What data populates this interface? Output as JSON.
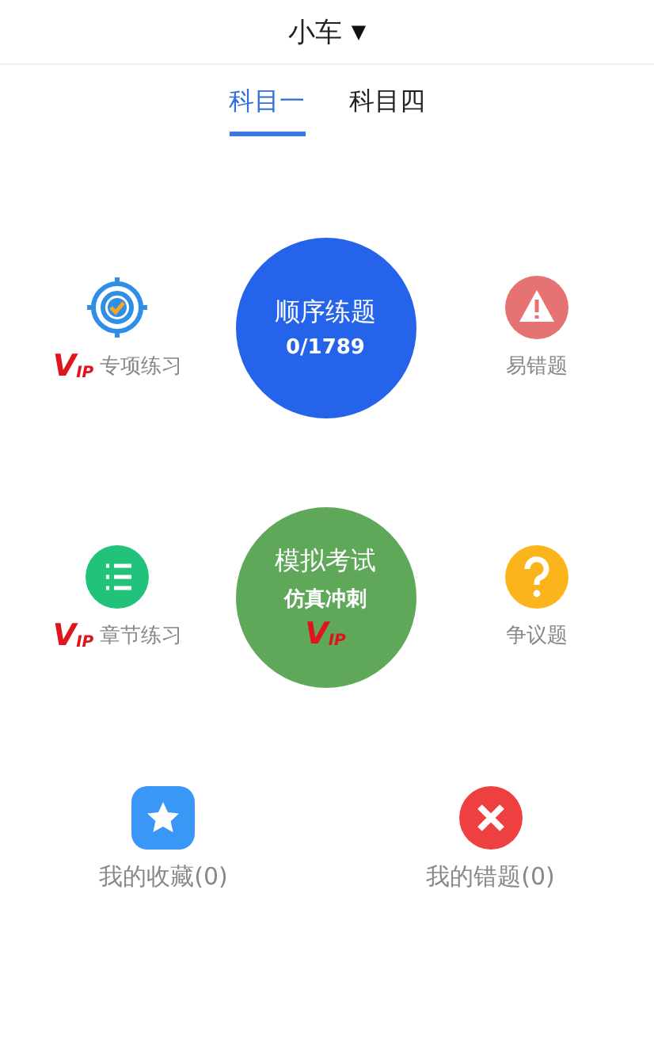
{
  "header": {
    "title": "小车",
    "caret": "▼"
  },
  "tabs": [
    {
      "label": "科目一",
      "selected": true
    },
    {
      "label": "科目四",
      "selected": false
    }
  ],
  "main_rows": [
    {
      "left": {
        "label": "专项练习",
        "badge": "VIP"
      },
      "center": {
        "title": "顺序练题",
        "subtitle": "0/1789",
        "color": "#2563eb"
      },
      "right": {
        "label": "易错题"
      }
    },
    {
      "left": {
        "label": "章节练习",
        "badge": "VIP"
      },
      "center": {
        "title": "模拟考试",
        "subtitle": "仿真冲刺",
        "badge": "VIP",
        "color": "#5fa85a"
      },
      "right": {
        "label": "争议题"
      }
    }
  ],
  "bottom_items": [
    {
      "label": "我的收藏(0)"
    },
    {
      "label": "我的错题(0)"
    }
  ]
}
